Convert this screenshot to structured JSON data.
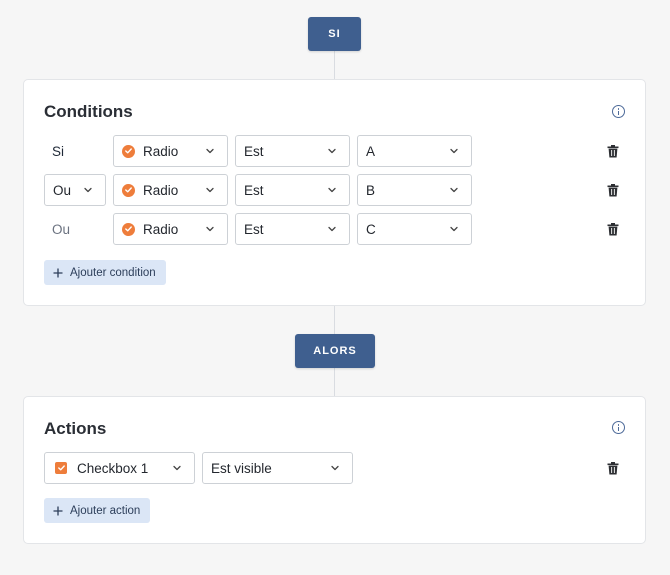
{
  "flow": {
    "if_label": "SI",
    "then_label": "ALORS"
  },
  "conditions": {
    "title": "Conditions",
    "rows": [
      {
        "connector": "Si",
        "field": "Radio",
        "operator": "Est",
        "value": "A"
      },
      {
        "connector": "Ou",
        "field": "Radio",
        "operator": "Est",
        "value": "B"
      },
      {
        "connector": "Ou",
        "field": "Radio",
        "operator": "Est",
        "value": "C"
      }
    ],
    "add_label": "Ajouter condition"
  },
  "actions": {
    "title": "Actions",
    "rows": [
      {
        "target": "Checkbox 1",
        "action": "Est visible"
      }
    ],
    "add_label": "Ajouter action"
  },
  "colors": {
    "accent": "#3f5f8f",
    "field_icon": "#ee7d3b",
    "add_button_bg": "#dbe6f6"
  },
  "icons": {
    "info": "info-icon",
    "delete": "trash-icon",
    "dropdown": "chevron-down-icon",
    "radio_field": "radio-check-icon",
    "checkbox_field": "checkbox-check-icon",
    "add": "plus-icon"
  }
}
